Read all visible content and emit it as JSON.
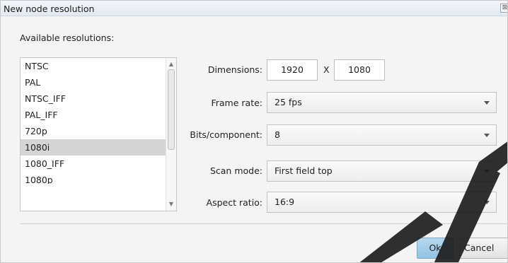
{
  "window": {
    "title": "New node resolution",
    "close_glyph": "⊠"
  },
  "resolutions": {
    "label": "Available resolutions:",
    "items": [
      "NTSC",
      "PAL",
      "NTSC_IFF",
      "PAL_IFF",
      "720p",
      "1080i",
      "1080_IFF",
      "1080p"
    ],
    "selected": "1080i"
  },
  "fields": {
    "dimensions_label": "Dimensions:",
    "width": "1920",
    "x_separator": "X",
    "height": "1080",
    "frame_rate_label": "Frame rate:",
    "frame_rate": "25 fps",
    "bits_label": "Bits/component:",
    "bits": "8",
    "scan_mode_label": "Scan mode:",
    "scan_mode": "First field top",
    "aspect_ratio_label": "Aspect ratio:",
    "aspect_ratio": "16:9"
  },
  "buttons": {
    "ok": "Ok",
    "cancel": "Cancel"
  },
  "icons": {
    "close": "close-icon",
    "combo_arrow": "chevron-down-icon",
    "scroll_up": "scroll-up-arrow-icon",
    "scroll_down": "scroll-down-arrow-icon"
  },
  "colors": {
    "title_bar": "#e3e9f2",
    "selected_row": "#d5d5d5",
    "ok_button": "#a6cde9"
  }
}
